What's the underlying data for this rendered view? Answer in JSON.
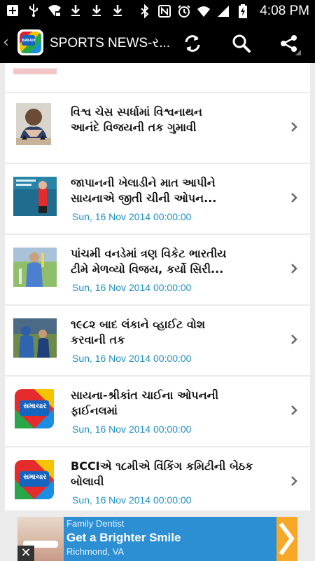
{
  "status_bar": {
    "time": "4:08 PM",
    "icons_left": [
      "add-box-icon",
      "usb-icon",
      "wifi-lock-icon",
      "download-icon",
      "download-icon",
      "download-icon"
    ],
    "icons_right": [
      "bluetooth-icon",
      "nfc-icon",
      "alarm-icon",
      "wifi-icon",
      "signal-icon",
      "battery-charging-icon"
    ]
  },
  "action_bar": {
    "title": "SPORTS NEWS-ર...",
    "logo_text": "સમાચાર",
    "actions": [
      "refresh-icon",
      "search-icon",
      "share-icon"
    ]
  },
  "news": [
    {
      "title_line1": "વિશ્વ ચેસ સ્પર્ધામાં વિશ્વનાથન",
      "title_line2": "આનંદે વિજયની તક ગુમાવી",
      "date": ""
    },
    {
      "title_line1": "જાપાનની ખેલાડીને માત આપીને",
      "title_line2": "સાયનાએ જીતી ચીની ઓપન...",
      "date": "Sun, 16 Nov 2014 00:00:00"
    },
    {
      "title_line1": "પાંચમી વનડેમાં ત્રણ વિકેટ ભારતીય",
      "title_line2": "ટીમે મેળવ્યો વિજય, કર્યો સિરી...",
      "date": "Sun, 16 Nov 2014 00:00:00"
    },
    {
      "title_line1": "૧૯૮૨ બાદ લંકાને વ્હાઈટ વોશ",
      "title_line2": "કરવાની તક",
      "date": "Sun, 16 Nov 2014 00:00:00"
    },
    {
      "title_line1": "સાયના-શ્રીકાંત ચાઈના ઓપનની",
      "title_line2": "ફાઈનલમાં",
      "date": "Sun, 16 Nov 2014 00:00:00"
    },
    {
      "title_line1": "BCCIએ ૧૮મીએ વિંકિંગ કમિટીની બેઠક",
      "title_line2": "બોલાવી",
      "date": "Sun, 16 Nov 2014 00:00:00"
    }
  ],
  "ad": {
    "line1": "Family Dentist",
    "line2": "Get a Brighter Smile",
    "line3": "Richmond, VA",
    "close": "✕"
  },
  "colors": {
    "date_text": "#1e8fc0",
    "ad_background": "#2d8fd3",
    "ad_arrow": "#f7a827"
  }
}
